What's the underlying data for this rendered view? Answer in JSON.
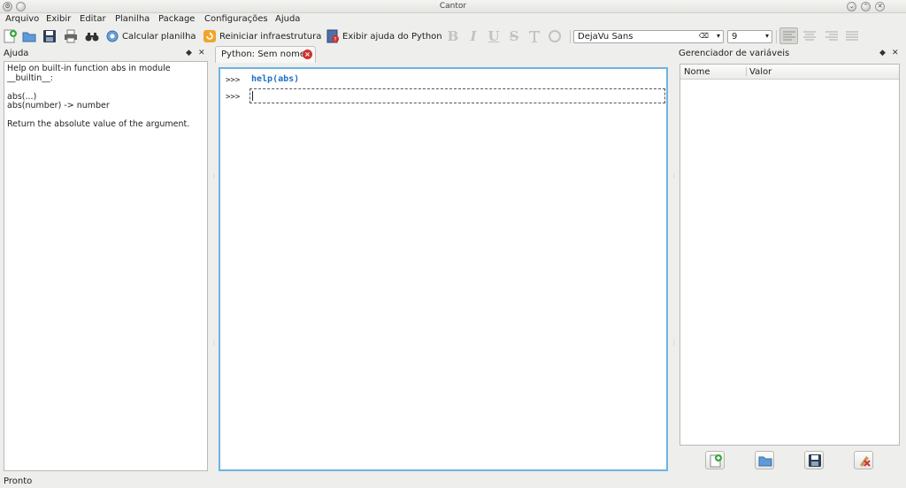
{
  "window": {
    "title": "Cantor"
  },
  "menu": [
    "Arquivo",
    "Exibir",
    "Editar",
    "Planilha",
    "Package",
    "Configurações",
    "Ajuda"
  ],
  "toolbar": {
    "new_icon": "new-document-icon",
    "open_icon": "open-folder-icon",
    "save_icon": "save-icon",
    "print_icon": "print-icon",
    "find_icon": "binoculars-icon",
    "calc_label": "Calcular planilha",
    "restart_label": "Reiniciar infraestrutura",
    "python_help_label": "Exibir ajuda do Python",
    "font_name": "DejaVu Sans",
    "font_size": "9",
    "format_buttons": [
      "B",
      "I",
      "U",
      "S"
    ]
  },
  "help_panel": {
    "title": "Ajuda",
    "lines": [
      "Help on built-in function abs in module",
      "__builtin__:",
      "",
      "abs(...)",
      "abs(number) -> number",
      "",
      "Return the absolute value of the argument."
    ]
  },
  "worksheet": {
    "tab_label": "Python: Sem nome",
    "prompt": ">>>",
    "entries": [
      "help(abs)"
    ],
    "current_input": ""
  },
  "variables_panel": {
    "title": "Gerenciador de variáveis",
    "columns": [
      "Nome",
      "Valor"
    ],
    "rows": [],
    "buttons": [
      "add-variable-icon",
      "load-variables-icon",
      "save-variables-icon",
      "clear-variables-icon"
    ]
  },
  "status": {
    "text": "Pronto"
  },
  "colors": {
    "accent": "#6fb3e0",
    "command": "#1d6fc5",
    "close": "#d0312d"
  }
}
